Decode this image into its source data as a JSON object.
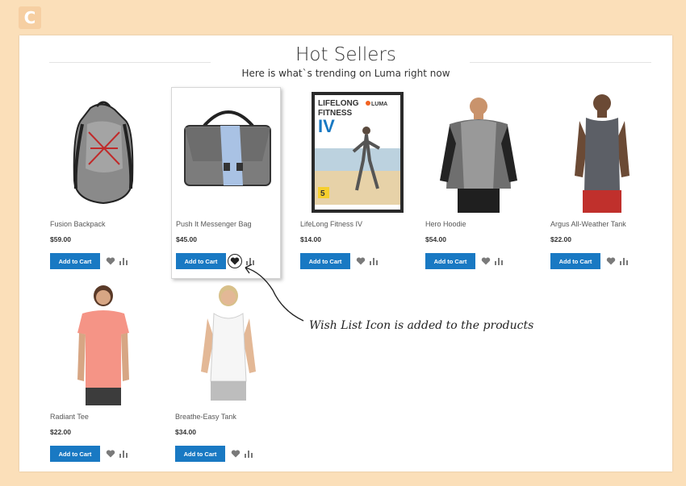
{
  "logo": {
    "mark": "C"
  },
  "section": {
    "title": "Hot Sellers",
    "subtitle": "Here is what`s trending on Luma right now"
  },
  "add_to_cart_label": "Add to Cart",
  "products": [
    {
      "name": "Fusion Backpack",
      "price": "$59.00"
    },
    {
      "name": "Push It Messenger Bag",
      "price": "$45.00",
      "dvd": {
        "line1": "LIFELONG",
        "line2": "FITNESS",
        "line3": "IV",
        "brand": "LUMA",
        "badge": "5"
      }
    },
    {
      "name": "LifeLong Fitness IV",
      "price": "$14.00"
    },
    {
      "name": "Hero Hoodie",
      "price": "$54.00"
    },
    {
      "name": "Argus All-Weather Tank",
      "price": "$22.00"
    },
    {
      "name": "Radiant Tee",
      "price": "$22.00"
    },
    {
      "name": "Breathe-Easy Tank",
      "price": "$34.00"
    }
  ],
  "annotation": {
    "text": "Wish List Icon is added to the products"
  },
  "colors": {
    "background": "#fbdfb9",
    "button": "#1979c3",
    "icon": "#7a7a7a"
  },
  "icons": [
    "heart-icon",
    "compare-icon"
  ]
}
